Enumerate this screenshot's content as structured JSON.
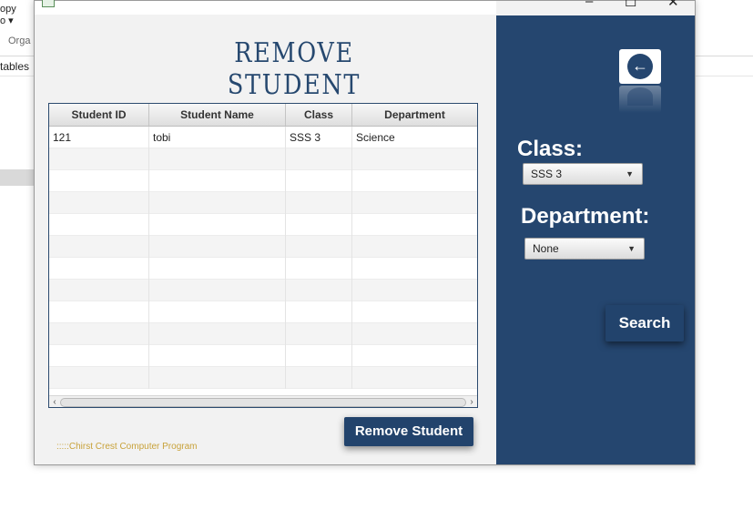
{
  "background": {
    "copy_label": "opy",
    "paste_label": "o",
    "organize_label": "Orga",
    "tables_label": "tables"
  },
  "window": {
    "minimize": "–",
    "maximize": "☐",
    "close": "✕"
  },
  "title": "REMOVE STUDENT",
  "table": {
    "columns": [
      "Student ID",
      "Student Name",
      "Class",
      "Department"
    ],
    "rows": [
      [
        "121",
        "tobi",
        "SSS 3",
        "Science"
      ]
    ],
    "empty_rows": 11
  },
  "remove_button": "Remove Student",
  "footer": ":::::Chirst Crest Computer Program",
  "panel": {
    "back_icon": "arrow-left-icon",
    "class_label": "Class:",
    "class_value": "SSS 3",
    "department_label": "Department:",
    "department_value": "None",
    "search_button": "Search"
  },
  "colors": {
    "accent": "#25466f",
    "button": "#22436c",
    "footer_text": "#c8a23a"
  }
}
